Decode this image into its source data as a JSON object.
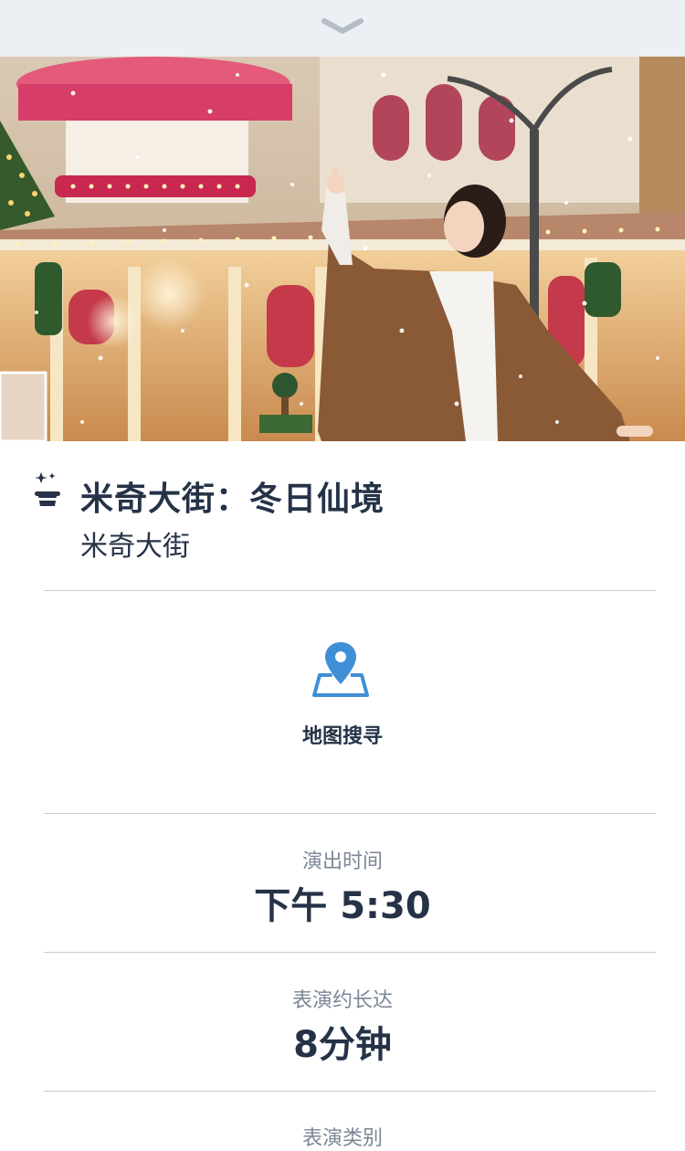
{
  "header": {
    "collapse_icon": "chevron-down-icon"
  },
  "hero": {
    "image_icon": "hero-photo"
  },
  "attraction": {
    "icon": "magic-hat-icon",
    "title": "米奇大街：冬日仙境",
    "location": "米奇大街"
  },
  "map_search": {
    "icon": "map-pin-icon",
    "label": "地图搜寻",
    "accent_color": "#3f8fd6"
  },
  "showtime": {
    "label": "演出时间",
    "value": "下午 5:30"
  },
  "duration": {
    "label": "表演约长达",
    "value": "8分钟"
  },
  "category": {
    "label": "表演类别"
  }
}
